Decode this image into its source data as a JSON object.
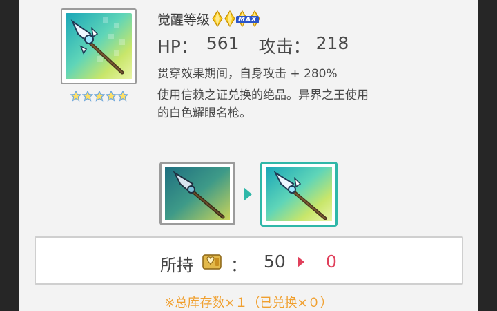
{
  "item": {
    "rarity_stars": 5,
    "awaken_label": "觉醒等级",
    "awaken_badge": "MAX",
    "hp_label": "HP：",
    "hp_value": "561",
    "atk_label": "攻击：",
    "atk_value": "218",
    "effect": "贯穿效果期间，自身攻击 + 280%",
    "desc_line1": "使用信赖之证兑换的绝品。异界之王使用",
    "desc_line2": "的白色耀眼名枪。"
  },
  "upgrade": {
    "from_icon": "spear-icon-base",
    "to_icon": "spear-icon-awakened"
  },
  "holding": {
    "label": "所持",
    "currency_icon": "trust-token-icon",
    "colon": "：",
    "from": "50",
    "to": "0"
  },
  "footnote": "※总库存数×１（已兑换×０）",
  "colors": {
    "accent_teal": "#2fb7a8",
    "warn_red": "#e0405b",
    "note_orange": "#f0a030",
    "crystal_gold": "#f4c21a"
  }
}
